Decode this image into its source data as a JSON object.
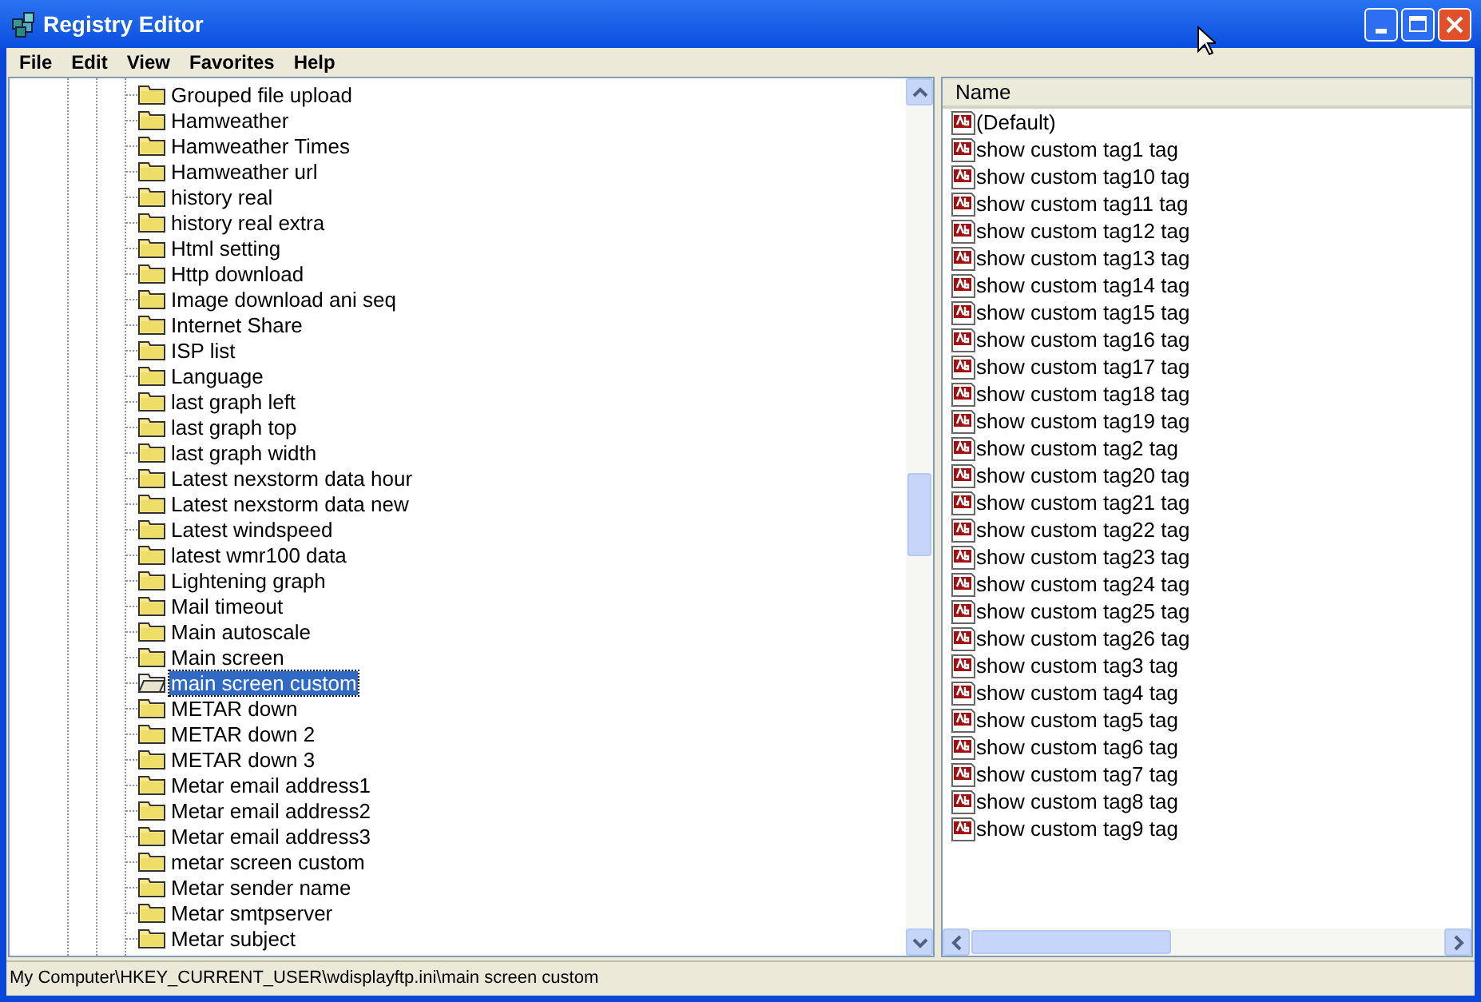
{
  "window": {
    "title": "Registry Editor"
  },
  "menu": [
    "File",
    "Edit",
    "View",
    "Favorites",
    "Help"
  ],
  "tree": [
    {
      "label": "Grouped file upload",
      "selected": false
    },
    {
      "label": "Hamweather",
      "selected": false
    },
    {
      "label": "Hamweather Times",
      "selected": false
    },
    {
      "label": "Hamweather url",
      "selected": false
    },
    {
      "label": "history real",
      "selected": false
    },
    {
      "label": "history real extra",
      "selected": false
    },
    {
      "label": "Html setting",
      "selected": false
    },
    {
      "label": "Http download",
      "selected": false
    },
    {
      "label": "Image download ani seq",
      "selected": false
    },
    {
      "label": "Internet Share",
      "selected": false
    },
    {
      "label": "ISP list",
      "selected": false
    },
    {
      "label": "Language",
      "selected": false
    },
    {
      "label": "last graph left",
      "selected": false
    },
    {
      "label": "last graph top",
      "selected": false
    },
    {
      "label": "last graph width",
      "selected": false
    },
    {
      "label": "Latest nexstorm data hour",
      "selected": false
    },
    {
      "label": "Latest nexstorm data new",
      "selected": false
    },
    {
      "label": "Latest windspeed",
      "selected": false
    },
    {
      "label": "latest wmr100 data",
      "selected": false
    },
    {
      "label": "Lightening graph",
      "selected": false
    },
    {
      "label": "Mail timeout",
      "selected": false
    },
    {
      "label": "Main autoscale",
      "selected": false
    },
    {
      "label": "Main screen",
      "selected": false
    },
    {
      "label": "main screen custom",
      "selected": true
    },
    {
      "label": "METAR down",
      "selected": false
    },
    {
      "label": "METAR down 2",
      "selected": false
    },
    {
      "label": "METAR down 3",
      "selected": false
    },
    {
      "label": "Metar email address1",
      "selected": false
    },
    {
      "label": "Metar email address2",
      "selected": false
    },
    {
      "label": "Metar email address3",
      "selected": false
    },
    {
      "label": "metar screen custom",
      "selected": false
    },
    {
      "label": "Metar sender name",
      "selected": false
    },
    {
      "label": "Metar smtpserver",
      "selected": false
    },
    {
      "label": "Metar subject",
      "selected": false
    }
  ],
  "values": {
    "columns": [
      "Name"
    ],
    "rows": [
      "(Default)",
      "show custom tag1 tag",
      "show custom tag10 tag",
      "show custom tag11 tag",
      "show custom tag12 tag",
      "show custom tag13 tag",
      "show custom tag14 tag",
      "show custom tag15 tag",
      "show custom tag16 tag",
      "show custom tag17 tag",
      "show custom tag18 tag",
      "show custom tag19 tag",
      "show custom tag2 tag",
      "show custom tag20 tag",
      "show custom tag21 tag",
      "show custom tag22 tag",
      "show custom tag23 tag",
      "show custom tag24 tag",
      "show custom tag25 tag",
      "show custom tag26 tag",
      "show custom tag3 tag",
      "show custom tag4 tag",
      "show custom tag5 tag",
      "show custom tag6 tag",
      "show custom tag7 tag",
      "show custom tag8 tag",
      "show custom tag9 tag"
    ]
  },
  "status_bar": "My Computer\\HKEY_CURRENT_USER\\wdisplayftp.ini\\main screen custom"
}
